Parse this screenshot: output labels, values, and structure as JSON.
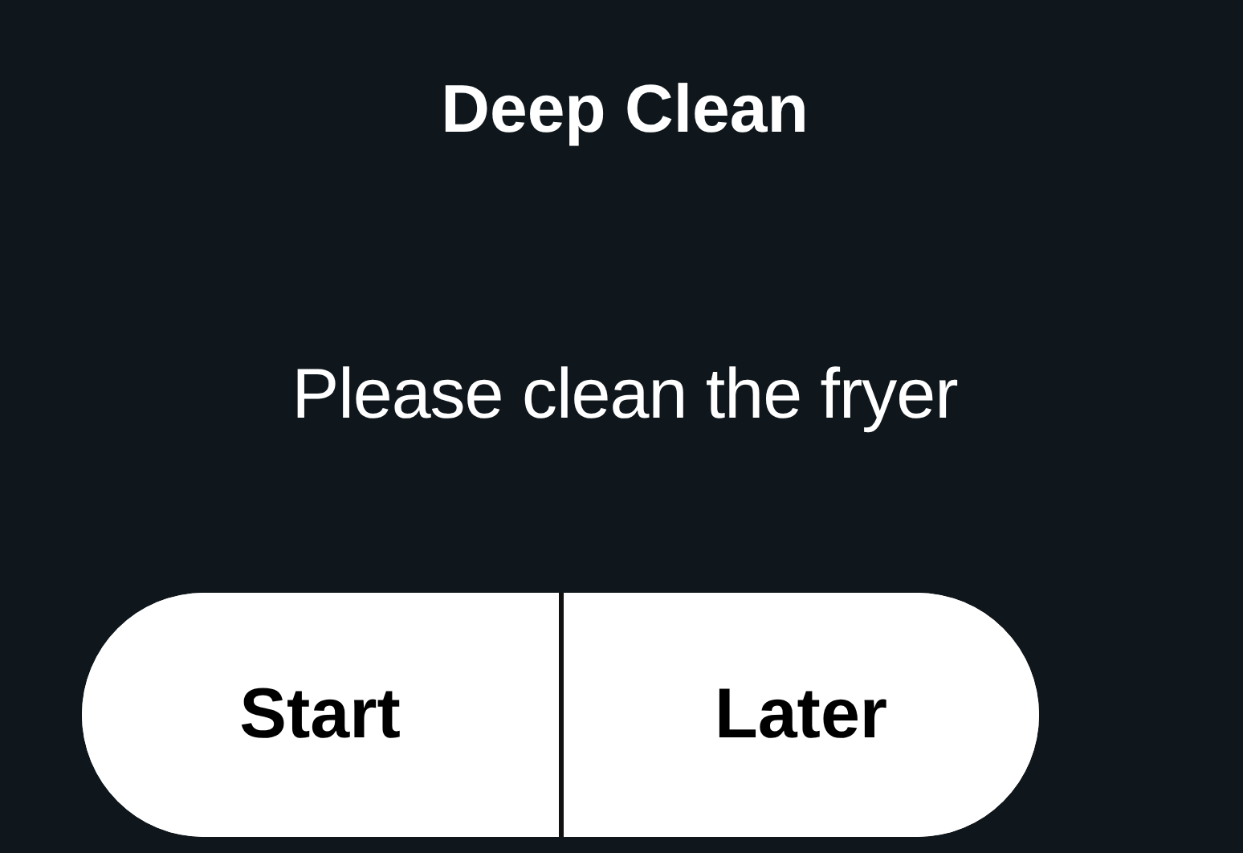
{
  "dialog": {
    "title": "Deep Clean",
    "message": "Please clean the fryer"
  },
  "buttons": [
    {
      "label": "Start"
    },
    {
      "label": "Later"
    }
  ]
}
